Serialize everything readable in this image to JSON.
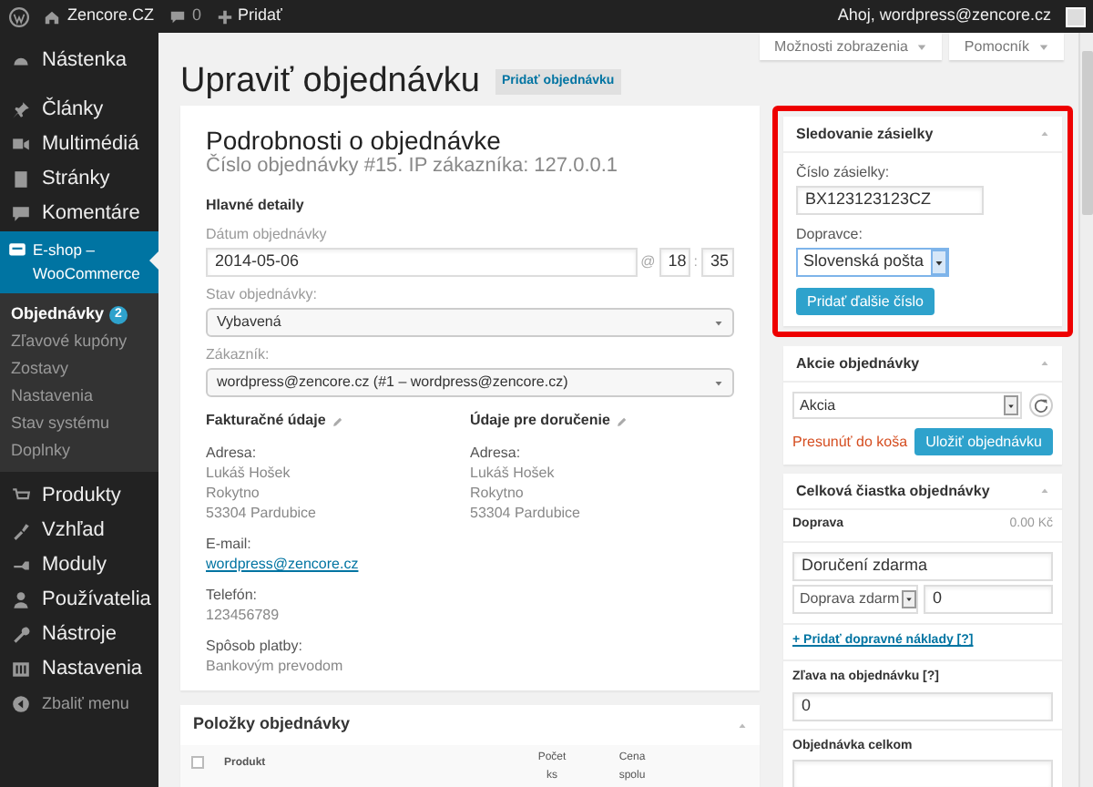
{
  "top_bar": {
    "site": "Zencore.CZ",
    "comments": "0",
    "new": "Pridať",
    "greeting": "Ahoj, wordpress@zencore.cz"
  },
  "sidebar": {
    "items": [
      {
        "label": "Nástenka",
        "selected": false
      },
      {
        "label": "Články",
        "selected": false
      },
      {
        "label": "Multimédiá",
        "selected": false
      },
      {
        "label": "Stránky",
        "selected": false
      },
      {
        "label": "Komentáre",
        "selected": false
      },
      {
        "label": "E-shop – WooCommerce",
        "selected": true,
        "children": [
          {
            "label": "Objednávky",
            "badge": "2",
            "selected": true
          },
          {
            "label": "Zľavové kupóny",
            "selected": false
          },
          {
            "label": "Zostavy",
            "selected": false
          },
          {
            "label": "Nastavenia",
            "selected": false
          },
          {
            "label": "Stav systému",
            "selected": false
          },
          {
            "label": "Doplnky",
            "selected": false
          }
        ]
      },
      {
        "label": "Produkty",
        "selected": false
      },
      {
        "label": "Vzhľad",
        "selected": false
      },
      {
        "label": "Moduly",
        "selected": false
      },
      {
        "label": "Používatelia",
        "selected": false
      },
      {
        "label": "Nástroje",
        "selected": false
      },
      {
        "label": "Nastavenia",
        "selected": false
      },
      {
        "label": "Zbaliť menu",
        "selected": false
      }
    ]
  },
  "screen_tabs": [
    "Možnosti zobrazenia",
    "Pomocník"
  ],
  "page_title": "Upraviť objednávku",
  "add_button": "Pridať objednávku",
  "order_details": {
    "title": "Podrobnosti o objednávke",
    "subtitle": "Číslo objednávky #15. IP zákazníka: 127.0.0.1",
    "section": "Hlavné detaily",
    "date_label": "Dátum objednávky",
    "date": "2014-05-06",
    "at": "@",
    "hour": "18",
    "colon": ":",
    "minute": "35",
    "status_label": "Stav objednávky:",
    "status": "Vybavená",
    "customer_label": "Zákazník:",
    "customer": "wordpress@zencore.cz (#1 – wordpress@zencore.cz)",
    "billing": {
      "title": "Fakturačné údaje",
      "fields": [
        {
          "label": "Adresa:",
          "lines": [
            "Lukáš Hošek",
            "Rokytno",
            "53304 Pardubice"
          ]
        },
        {
          "label": "E-mail:",
          "link": "wordpress@zencore.cz"
        },
        {
          "label": "Telefón:",
          "lines": [
            "123456789"
          ]
        },
        {
          "label": "Spôsob platby:",
          "lines": [
            "Bankovým prevodom"
          ]
        }
      ]
    },
    "shipping": {
      "title": "Údaje pre doručenie",
      "fields": [
        {
          "label": "Adresa:",
          "lines": [
            "Lukáš Hošek",
            "Rokytno",
            "53304 Pardubice"
          ]
        }
      ]
    }
  },
  "order_items": {
    "title": "Položky objednávky",
    "columns": [
      "Produkt",
      "Počet ks",
      "Cena spolu"
    ],
    "select_all_checked": false
  },
  "tracking": {
    "title": "Sledovanie zásielky",
    "number_label": "Číslo zásielky:",
    "number": "BX123123123CZ",
    "carrier_label": "Dopravce:",
    "carrier": "Slovenská pošta",
    "button": "Pridať ďalšie číslo"
  },
  "actions": {
    "title": "Akcie objednávky",
    "action": "Akcia",
    "trash": "Presunúť do koša",
    "save": "Uložiť objednávku"
  },
  "totals": {
    "title": "Celková čiastka objednávky",
    "shipping_label": "Doprava",
    "shipping_amount": "0.00 Kč",
    "shipping_name": "Doručení zdarma",
    "shipping_method": "Doprava zdarm",
    "shipping_cost": "0",
    "add_link": "+ Pridať dopravné náklady [?]",
    "discount_label": "Zľava na objednávku [?]",
    "discount": "0",
    "total_label": "Objednávka celkom"
  }
}
